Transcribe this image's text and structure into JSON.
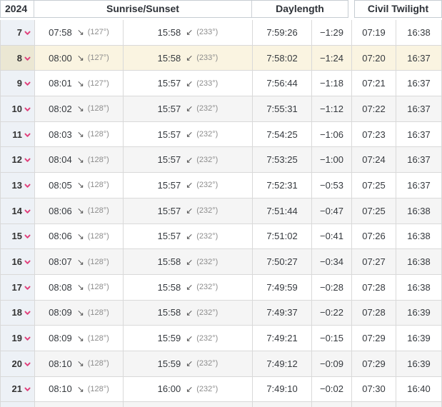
{
  "header": {
    "year": "2024",
    "sunrise_sunset": "Sunrise/Sunset",
    "daylength": "Daylength",
    "civil_twilight": "Civil Twilight"
  },
  "icons": {
    "sunrise_arrow": "↘",
    "sunset_arrow": "↙",
    "chevron_down": "v"
  },
  "colors": {
    "chevron": "#e0417c",
    "today_row": "#faf4e1",
    "today_date_cell": "#ebe7d3",
    "date_column": "#edf1f6",
    "stripe_row": "#f5f5f5",
    "border": "#d9d9d9"
  },
  "table": {
    "rows": [
      {
        "day": "7",
        "sunrise": "07:58",
        "sunrise_az": "(127°)",
        "sunset": "15:58",
        "sunset_az": "(233°)",
        "daylength": "7:59:26",
        "diff": "−1:29",
        "civil_start": "07:19",
        "civil_end": "16:38",
        "stripe": false,
        "highlight": false
      },
      {
        "day": "8",
        "sunrise": "08:00",
        "sunrise_az": "(127°)",
        "sunset": "15:58",
        "sunset_az": "(233°)",
        "daylength": "7:58:02",
        "diff": "−1:24",
        "civil_start": "07:20",
        "civil_end": "16:37",
        "stripe": false,
        "highlight": true
      },
      {
        "day": "9",
        "sunrise": "08:01",
        "sunrise_az": "(127°)",
        "sunset": "15:57",
        "sunset_az": "(233°)",
        "daylength": "7:56:44",
        "diff": "−1:18",
        "civil_start": "07:21",
        "civil_end": "16:37",
        "stripe": false,
        "highlight": false
      },
      {
        "day": "10",
        "sunrise": "08:02",
        "sunrise_az": "(128°)",
        "sunset": "15:57",
        "sunset_az": "(232°)",
        "daylength": "7:55:31",
        "diff": "−1:12",
        "civil_start": "07:22",
        "civil_end": "16:37",
        "stripe": true,
        "highlight": false
      },
      {
        "day": "11",
        "sunrise": "08:03",
        "sunrise_az": "(128°)",
        "sunset": "15:57",
        "sunset_az": "(232°)",
        "daylength": "7:54:25",
        "diff": "−1:06",
        "civil_start": "07:23",
        "civil_end": "16:37",
        "stripe": false,
        "highlight": false
      },
      {
        "day": "12",
        "sunrise": "08:04",
        "sunrise_az": "(128°)",
        "sunset": "15:57",
        "sunset_az": "(232°)",
        "daylength": "7:53:25",
        "diff": "−1:00",
        "civil_start": "07:24",
        "civil_end": "16:37",
        "stripe": true,
        "highlight": false
      },
      {
        "day": "13",
        "sunrise": "08:05",
        "sunrise_az": "(128°)",
        "sunset": "15:57",
        "sunset_az": "(232°)",
        "daylength": "7:52:31",
        "diff": "−0:53",
        "civil_start": "07:25",
        "civil_end": "16:37",
        "stripe": false,
        "highlight": false
      },
      {
        "day": "14",
        "sunrise": "08:06",
        "sunrise_az": "(128°)",
        "sunset": "15:57",
        "sunset_az": "(232°)",
        "daylength": "7:51:44",
        "diff": "−0:47",
        "civil_start": "07:25",
        "civil_end": "16:38",
        "stripe": true,
        "highlight": false
      },
      {
        "day": "15",
        "sunrise": "08:06",
        "sunrise_az": "(128°)",
        "sunset": "15:57",
        "sunset_az": "(232°)",
        "daylength": "7:51:02",
        "diff": "−0:41",
        "civil_start": "07:26",
        "civil_end": "16:38",
        "stripe": false,
        "highlight": false
      },
      {
        "day": "16",
        "sunrise": "08:07",
        "sunrise_az": "(128°)",
        "sunset": "15:58",
        "sunset_az": "(232°)",
        "daylength": "7:50:27",
        "diff": "−0:34",
        "civil_start": "07:27",
        "civil_end": "16:38",
        "stripe": true,
        "highlight": false
      },
      {
        "day": "17",
        "sunrise": "08:08",
        "sunrise_az": "(128°)",
        "sunset": "15:58",
        "sunset_az": "(232°)",
        "daylength": "7:49:59",
        "diff": "−0:28",
        "civil_start": "07:28",
        "civil_end": "16:38",
        "stripe": false,
        "highlight": false
      },
      {
        "day": "18",
        "sunrise": "08:09",
        "sunrise_az": "(128°)",
        "sunset": "15:58",
        "sunset_az": "(232°)",
        "daylength": "7:49:37",
        "diff": "−0:22",
        "civil_start": "07:28",
        "civil_end": "16:39",
        "stripe": true,
        "highlight": false
      },
      {
        "day": "19",
        "sunrise": "08:09",
        "sunrise_az": "(128°)",
        "sunset": "15:59",
        "sunset_az": "(232°)",
        "daylength": "7:49:21",
        "diff": "−0:15",
        "civil_start": "07:29",
        "civil_end": "16:39",
        "stripe": false,
        "highlight": false
      },
      {
        "day": "20",
        "sunrise": "08:10",
        "sunrise_az": "(128°)",
        "sunset": "15:59",
        "sunset_az": "(232°)",
        "daylength": "7:49:12",
        "diff": "−0:09",
        "civil_start": "07:29",
        "civil_end": "16:39",
        "stripe": true,
        "highlight": false
      },
      {
        "day": "21",
        "sunrise": "08:10",
        "sunrise_az": "(128°)",
        "sunset": "16:00",
        "sunset_az": "(232°)",
        "daylength": "7:49:10",
        "diff": "−0:02",
        "civil_start": "07:30",
        "civil_end": "16:40",
        "stripe": false,
        "highlight": false
      }
    ]
  }
}
